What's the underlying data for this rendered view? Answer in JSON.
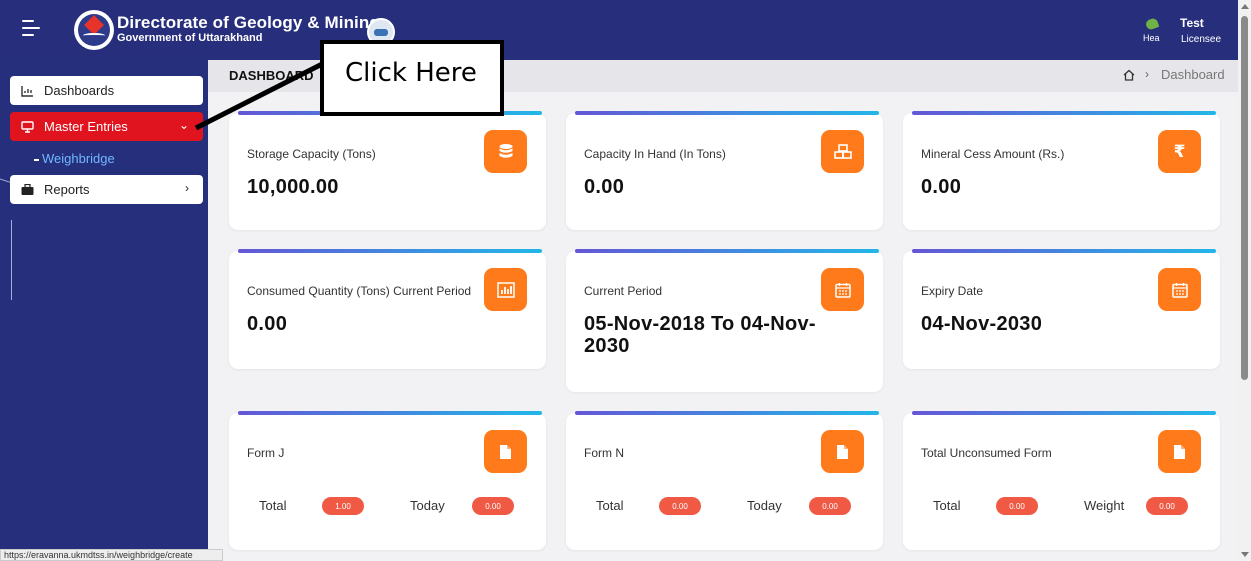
{
  "header": {
    "title": "Directorate of Geology & Mining",
    "subtitle": "Government of Uttarakhand",
    "user_name": "Test",
    "user_role": "Licensee",
    "user_avatar_text": "Hea"
  },
  "sidebar": {
    "items": [
      {
        "label": "Dashboards",
        "icon": "chart-icon"
      },
      {
        "label": "Master Entries",
        "icon": "monitor-icon",
        "chevron": "⌄"
      },
      {
        "label": "Reports",
        "icon": "briefcase-icon",
        "chevron": "›"
      }
    ],
    "sub_item": "Weighbridge"
  },
  "breadcrumb": {
    "title": "DASHBOARD",
    "sep": "›",
    "page": "Dashboard"
  },
  "callout": {
    "text": "Click Here"
  },
  "cards": [
    {
      "label": "Storage Capacity (Tons)",
      "value": "10,000.00",
      "icon": "database-icon"
    },
    {
      "label": "Capacity In Hand (In Tons)",
      "value": "0.00",
      "icon": "boxes-icon"
    },
    {
      "label": "Mineral Cess Amount (Rs.)",
      "value": "0.00",
      "icon": "rupee-icon",
      "glyph": "₹"
    },
    {
      "label": "Consumed Quantity (Tons) Current Period",
      "value": "0.00",
      "icon": "bar-chart-icon"
    },
    {
      "label": "Current Period",
      "value_line1": "05-Nov-2018 To 04-Nov-",
      "value_line2": "2030",
      "icon": "calendar-icon"
    },
    {
      "label": "Expiry Date",
      "value": "04-Nov-2030",
      "icon": "calendar-icon"
    },
    {
      "label": "Form J",
      "icon": "file-icon",
      "stat1_label": "Total",
      "stat1_value": "1.00",
      "stat2_label": "Today",
      "stat2_value": "0.00"
    },
    {
      "label": "Form N",
      "icon": "file-icon",
      "stat1_label": "Total",
      "stat1_value": "0.00",
      "stat2_label": "Today",
      "stat2_value": "0.00"
    },
    {
      "label": "Total Unconsumed Form",
      "icon": "file-icon",
      "stat1_label": "Total",
      "stat1_value": "0.00",
      "stat2_label": "Weight",
      "stat2_value": "0.00"
    }
  ],
  "status_url": "https://eravanna.ukmdtss.in/weighbridge/create",
  "colors": {
    "header_bg": "#272f7d",
    "sidebar_active": "#e0141e",
    "icon_box": "#ff7a1a",
    "pill": "#f05a45",
    "link": "#6fb8ff"
  }
}
